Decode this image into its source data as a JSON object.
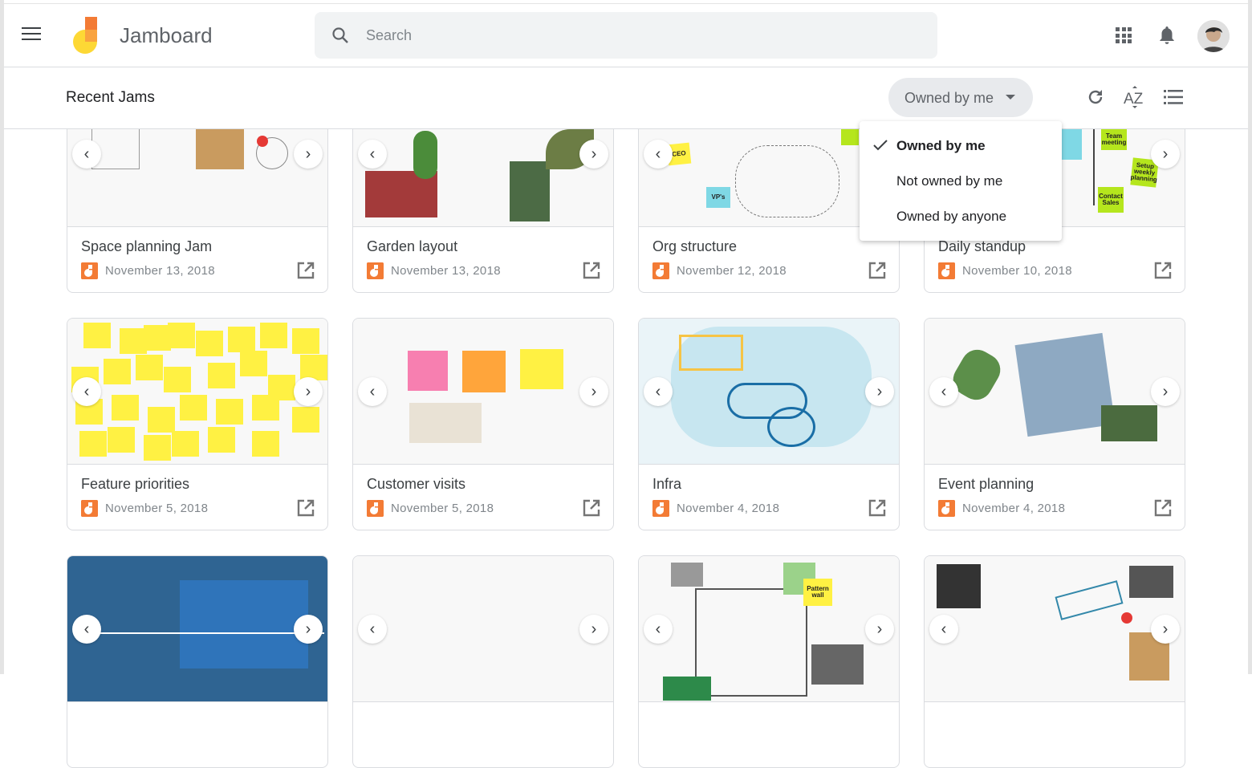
{
  "app": {
    "title": "Jamboard"
  },
  "search": {
    "placeholder": "Search"
  },
  "subheader": {
    "title": "Recent Jams",
    "filter_label": "Owned by me"
  },
  "filter_menu": {
    "items": [
      {
        "label": "Owned by me",
        "selected": true
      },
      {
        "label": "Not owned by me",
        "selected": false
      },
      {
        "label": "Owned by anyone",
        "selected": false
      }
    ]
  },
  "thumb_text": {
    "team": "Team meeting",
    "setup": "Setup weekly planning",
    "contact": "Contact Sales",
    "ceo": "CEO",
    "vps": "VP's",
    "pattern": "Pattern wall"
  },
  "colors": {
    "accent": "#f37b35",
    "sticky_yellow": "#fff143",
    "sticky_green": "#b5e61d",
    "sticky_blue": "#7fd8e5"
  },
  "cards": [
    {
      "title": "Space planning Jam",
      "date": "November 13, 2018"
    },
    {
      "title": "Garden layout",
      "date": "November 13, 2018"
    },
    {
      "title": "Org structure",
      "date": "November 12, 2018"
    },
    {
      "title": "Daily standup",
      "date": "November 10, 2018"
    },
    {
      "title": "Feature priorities",
      "date": "November 5, 2018"
    },
    {
      "title": "Customer visits",
      "date": "November 5, 2018"
    },
    {
      "title": "Infra",
      "date": "November 4, 2018"
    },
    {
      "title": "Event planning",
      "date": "November 4, 2018"
    },
    {
      "title": "",
      "date": ""
    },
    {
      "title": "",
      "date": ""
    },
    {
      "title": "",
      "date": ""
    },
    {
      "title": "",
      "date": ""
    }
  ]
}
